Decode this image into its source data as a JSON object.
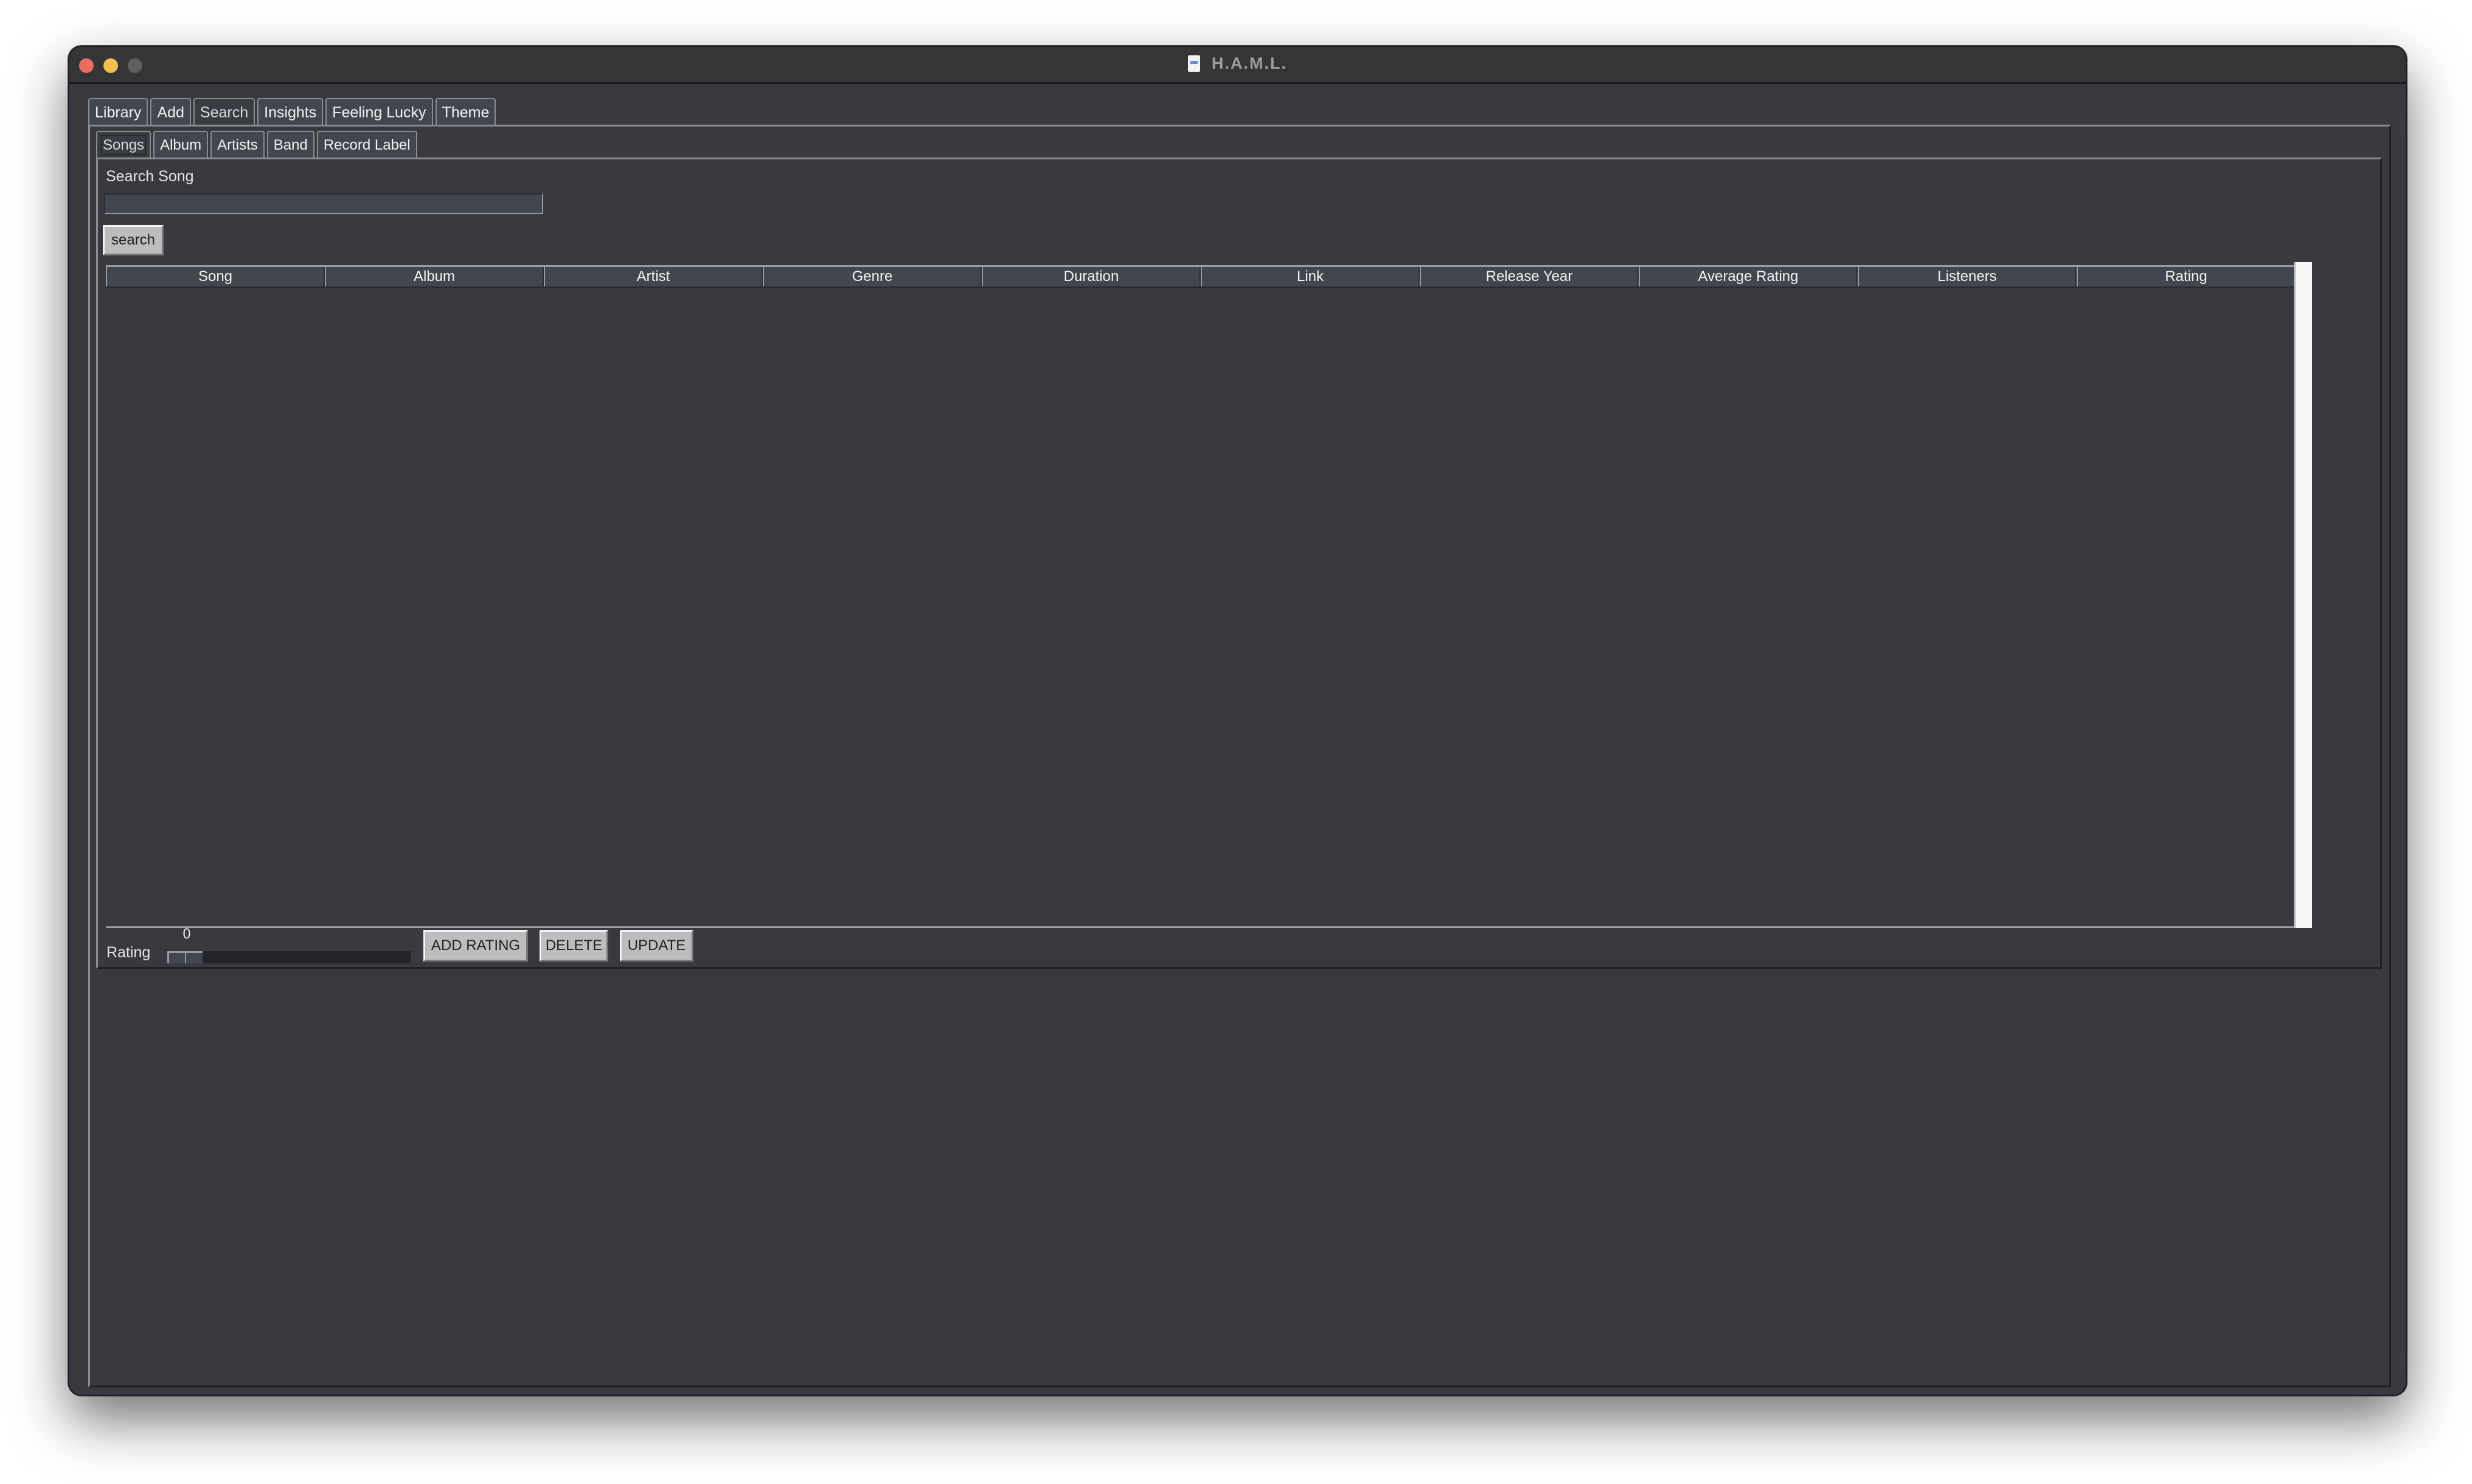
{
  "window": {
    "title": "H.A.M.L.",
    "title_icon": "document-icon",
    "controls": [
      "close",
      "minimize",
      "maximize"
    ]
  },
  "main_tabs": [
    {
      "label": "Library",
      "active": false
    },
    {
      "label": "Add",
      "active": false
    },
    {
      "label": "Search",
      "active": true
    },
    {
      "label": "Insights",
      "active": false
    },
    {
      "label": "Feeling Lucky",
      "active": false
    },
    {
      "label": "Theme",
      "active": false
    }
  ],
  "sub_tabs": [
    {
      "label": "Songs",
      "active": true
    },
    {
      "label": "Album",
      "active": false
    },
    {
      "label": "Artists",
      "active": false
    },
    {
      "label": "Band",
      "active": false
    },
    {
      "label": "Record Label",
      "active": false
    }
  ],
  "search": {
    "label": "Search Song",
    "value": "",
    "placeholder": "",
    "button_label": "search"
  },
  "table": {
    "columns": [
      "Song",
      "Album",
      "Artist",
      "Genre",
      "Duration",
      "Link",
      "Release Year",
      "Average Rating",
      "Listeners",
      "Rating"
    ],
    "rows": []
  },
  "rating": {
    "label": "Rating",
    "value": "0"
  },
  "actions": {
    "add_rating": "ADD RATING",
    "delete": "DELETE",
    "update": "UPDATE"
  },
  "colors": {
    "background": "#383a40",
    "titlebar": "#343536",
    "tab": "#44464f",
    "button": "#bdbdc0",
    "close": "#ec6a5e",
    "minimize": "#f4bf4f",
    "maximize": "#5e5f60"
  }
}
